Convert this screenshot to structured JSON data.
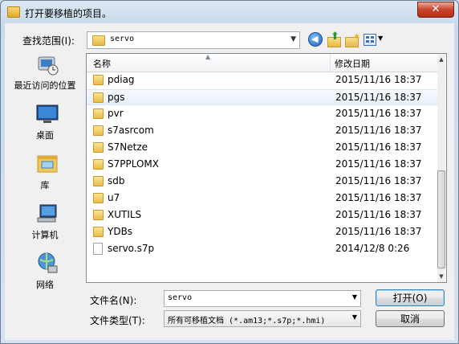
{
  "window": {
    "title": "打开要移植的项目。",
    "close_label": "✕"
  },
  "lookin": {
    "label": "查找范围(I):",
    "value": "servo"
  },
  "places": [
    {
      "label": "最近访问的位置",
      "icon": "recent-places-icon"
    },
    {
      "label": "桌面",
      "icon": "desktop-icon"
    },
    {
      "label": "库",
      "icon": "libraries-icon"
    },
    {
      "label": "计算机",
      "icon": "computer-icon"
    },
    {
      "label": "网络",
      "icon": "network-icon"
    }
  ],
  "list": {
    "columns": {
      "name": "名称",
      "date": "修改日期"
    },
    "rows": [
      {
        "name": "pdiag",
        "date": "2015/11/16 18:37",
        "type": "folder"
      },
      {
        "name": "pgs",
        "date": "2015/11/16 18:37",
        "type": "folder"
      },
      {
        "name": "pvr",
        "date": "2015/11/16 18:37",
        "type": "folder"
      },
      {
        "name": "s7asrcom",
        "date": "2015/11/16 18:37",
        "type": "folder"
      },
      {
        "name": "S7Netze",
        "date": "2015/11/16 18:37",
        "type": "folder"
      },
      {
        "name": "S7PPLOMX",
        "date": "2015/11/16 18:37",
        "type": "folder"
      },
      {
        "name": "sdb",
        "date": "2015/11/16 18:37",
        "type": "folder"
      },
      {
        "name": "u7",
        "date": "2015/11/16 18:37",
        "type": "folder"
      },
      {
        "name": "XUTILS",
        "date": "2015/11/16 18:37",
        "type": "folder"
      },
      {
        "name": "YDBs",
        "date": "2015/11/16 18:37",
        "type": "folder"
      },
      {
        "name": "servo.s7p",
        "date": "2014/12/8 0:26",
        "type": "file"
      }
    ]
  },
  "filename": {
    "label": "文件名(N):",
    "value": "servo"
  },
  "filetype": {
    "label": "文件类型(T):",
    "value": "所有可移植文档 (*.am13;*.s7p;*.hmi)"
  },
  "buttons": {
    "open": "打开(O)",
    "cancel": "取消"
  },
  "colors": {
    "selection": "#e6f0fb",
    "close": "#c9442c"
  }
}
